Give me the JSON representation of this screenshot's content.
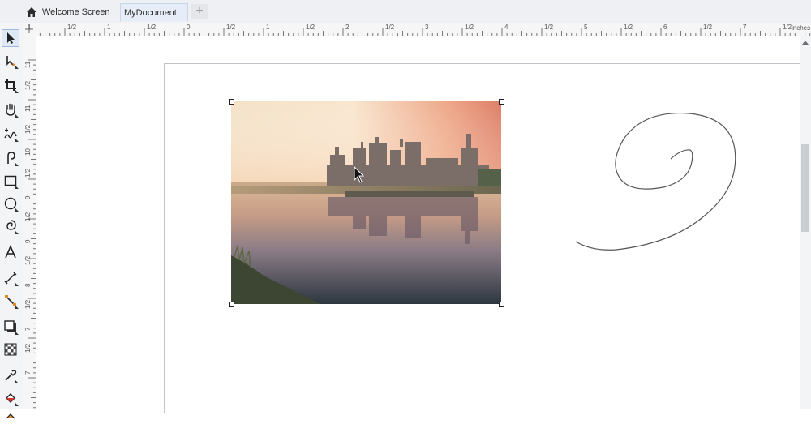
{
  "tabs": {
    "welcome_label": "Welcome Screen",
    "document_label": "MyDocument",
    "add_label": "+"
  },
  "ruler": {
    "unit": "inches",
    "horizontal_labels": [
      "1",
      "1/2",
      "1",
      "1/2",
      "0",
      "1/2",
      "1",
      "1/2",
      "2",
      "1/2",
      "3",
      "1/2",
      "4",
      "1/2",
      "5",
      "1/2",
      "6",
      "1/2",
      "7",
      "1/2"
    ],
    "vertical_labels": [
      "11",
      "1/2",
      "11",
      "1/2",
      "10",
      "1/2",
      "9",
      "1/2",
      "9",
      "1/2",
      "8",
      "1/2",
      "7",
      "1/2",
      "7"
    ]
  },
  "toolbox": {
    "tools": [
      "pick-tool-icon",
      "shape-tool-icon",
      "crop-tool-icon",
      "pan-tool-icon",
      "freehand-tool-icon",
      "artistic-media-icon",
      "rectangle-tool-icon",
      "ellipse-tool-icon",
      "spiral-tool-icon",
      "text-tool-icon",
      "parallel-dimension-icon",
      "connector-tool-icon",
      "drop-shadow-icon",
      "transparency-tool-icon",
      "eyedropper-tool-icon",
      "interactive-fill-icon",
      "smart-fill-icon"
    ]
  },
  "colors": {
    "selection_tab": "#e6edf8",
    "spiral_stroke": "#555555",
    "sky_top": "#f7d9b8",
    "sky_right": "#e58a6a",
    "water_bottom": "#2a3540"
  }
}
